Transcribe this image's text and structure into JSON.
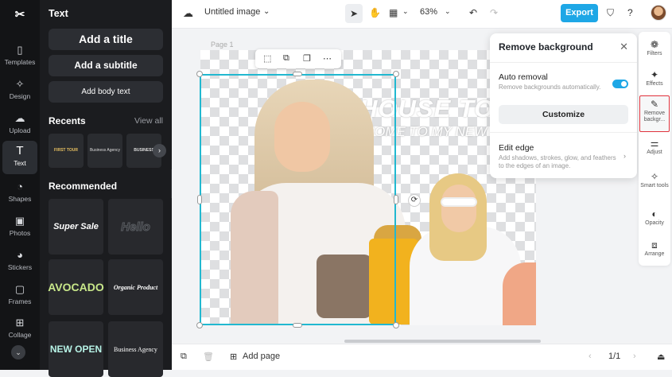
{
  "sidebar": {
    "items": [
      {
        "label": "Templates",
        "icon": "templates-icon"
      },
      {
        "label": "Design",
        "icon": "design-icon"
      },
      {
        "label": "Upload",
        "icon": "upload-icon"
      },
      {
        "label": "Text",
        "icon": "text-icon"
      },
      {
        "label": "Shapes",
        "icon": "shapes-icon"
      },
      {
        "label": "Photos",
        "icon": "photos-icon"
      },
      {
        "label": "Stickers",
        "icon": "stickers-icon"
      },
      {
        "label": "Frames",
        "icon": "frames-icon"
      },
      {
        "label": "Collage",
        "icon": "collage-icon"
      }
    ]
  },
  "panel": {
    "title": "Text",
    "add_title": "Add a title",
    "add_subtitle": "Add a subtitle",
    "add_body": "Add body text",
    "recents_heading": "Recents",
    "view_all": "View all",
    "recents": [
      "FIRST TOUR",
      "Business Agency",
      "BUSINESS AGENCY"
    ],
    "recommended_heading": "Recommended",
    "recommended": [
      "Super Sale",
      "Hello",
      "AVOCADO",
      "Organic Product",
      "NEW OPEN",
      "Business Agency"
    ]
  },
  "topbar": {
    "doc_title": "Untitled image",
    "zoom": "63%",
    "export_label": "Export"
  },
  "canvas": {
    "page_label": "Page 1",
    "headline": "HOUSE TOU",
    "subheadline": "WELCOME TO MY NEW"
  },
  "remove_bg_panel": {
    "title": "Remove background",
    "auto_label": "Auto removal",
    "auto_desc": "Remove backgrounds automatically.",
    "auto_enabled": true,
    "customize_label": "Customize",
    "edit_edge_label": "Edit edge",
    "edit_edge_desc": "Add shadows, strokes, glow, and feathers to the edges of an image."
  },
  "tools": [
    {
      "label": "Filters",
      "icon": "filters-icon"
    },
    {
      "label": "Effects",
      "icon": "effects-icon"
    },
    {
      "label": "Remove backgr...",
      "icon": "remove-background-icon"
    },
    {
      "label": "Adjust",
      "icon": "adjust-icon"
    },
    {
      "label": "Smart tools",
      "icon": "smart-tools-icon"
    },
    {
      "label": "Opacity",
      "icon": "opacity-icon"
    },
    {
      "label": "Arrange",
      "icon": "arrange-icon"
    }
  ],
  "bottombar": {
    "add_page": "Add page",
    "page_count": "1/1"
  },
  "colors": {
    "accent": "#1ea7e6",
    "selection": "#22b8d0",
    "highlight": "#e0323c"
  }
}
